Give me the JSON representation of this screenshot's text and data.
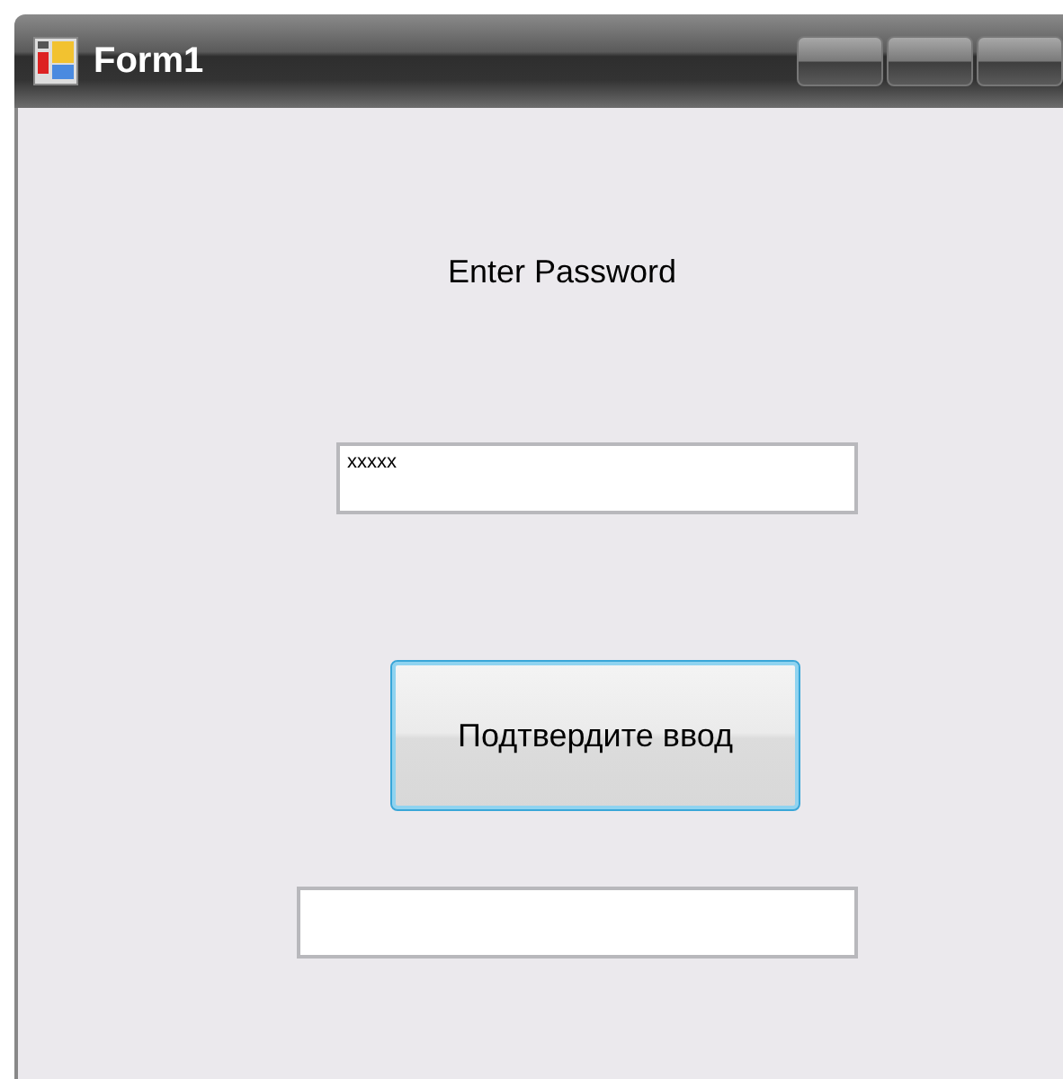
{
  "window": {
    "title": "Form1"
  },
  "prompt": "Enter Password",
  "password_field": {
    "value": "xxxxx"
  },
  "confirm_button": {
    "label": "Подтвердите ввод",
    "focused": true
  }
}
